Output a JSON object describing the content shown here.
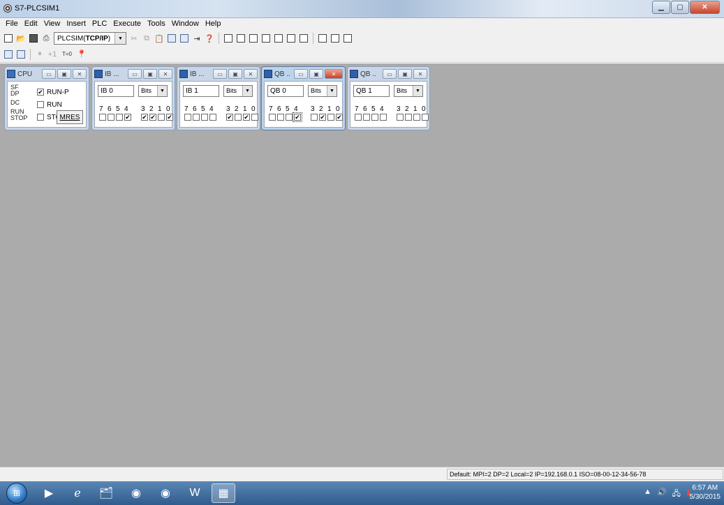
{
  "window": {
    "title": "S7-PLCSIM1"
  },
  "menu": [
    "File",
    "Edit",
    "View",
    "Insert",
    "PLC",
    "Execute",
    "Tools",
    "Window",
    "Help"
  ],
  "toolbar": {
    "interface_prefix": "PLCSIM(",
    "interface_bold": "TCP/IP",
    "interface_suffix": ")",
    "reset_label": "T=0"
  },
  "cpu": {
    "title": "CPU",
    "leds": [
      "SF",
      "DP",
      "DC",
      "RUN",
      "STOP"
    ],
    "run_p_label": "RUN-P",
    "run_label": "RUN",
    "stop_label": "STOP",
    "mres_label": "MRES",
    "run_p_checked": true,
    "run_checked": false,
    "stop_checked": false
  },
  "io_windows": [
    {
      "title": "IB ...",
      "address": "IB  0",
      "format": "Bits",
      "bits_checked": [
        false,
        false,
        false,
        true,
        true,
        true,
        false,
        true
      ],
      "active": false
    },
    {
      "title": "IB ...",
      "address": "IB  1",
      "format": "Bits",
      "bits_checked": [
        false,
        false,
        false,
        false,
        true,
        false,
        true,
        false
      ],
      "active": false
    },
    {
      "title": "QB ...",
      "address": "QB  0",
      "format": "Bits",
      "bits_checked": [
        false,
        false,
        false,
        true,
        false,
        true,
        false,
        true
      ],
      "active": true
    },
    {
      "title": "QB ...",
      "address": "QB  1",
      "format": "Bits",
      "bits_checked": [
        false,
        false,
        false,
        false,
        false,
        false,
        false,
        false
      ],
      "active": false
    }
  ],
  "bit_labels": [
    "7",
    "6",
    "5",
    "4",
    "3",
    "2",
    "1",
    "0"
  ],
  "status": {
    "text": "Default:  MPI=2 DP=2 Local=2 IP=192.168.0.1 ISO=08-00-12-34-56-78"
  },
  "taskbar": {
    "time": "6:57 AM",
    "date": "5/30/2015"
  }
}
